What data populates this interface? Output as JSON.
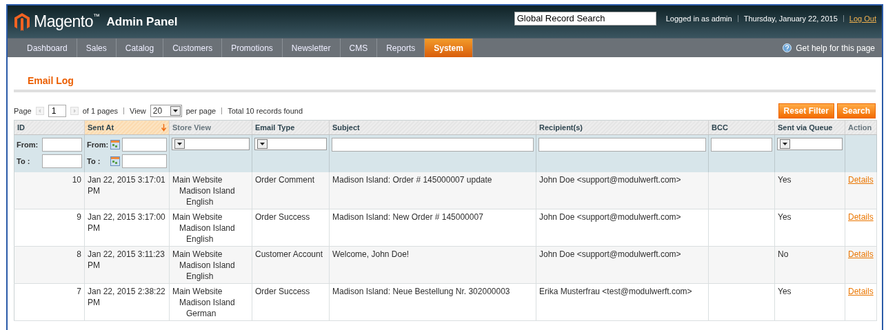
{
  "header": {
    "logo": "Magento",
    "logo_mark": "™",
    "logo_suffix": "Admin Panel",
    "search": {
      "value": "Global Record Search"
    },
    "user": "Logged in as admin",
    "date": "Thursday, January 22, 2015",
    "logout": "Log Out"
  },
  "nav": {
    "items": [
      {
        "label": "Dashboard",
        "selected": false
      },
      {
        "label": "Sales",
        "selected": false
      },
      {
        "label": "Catalog",
        "selected": false
      },
      {
        "label": "Customers",
        "selected": false
      },
      {
        "label": "Promotions",
        "selected": false
      },
      {
        "label": "Newsletter",
        "selected": false
      },
      {
        "label": "CMS",
        "selected": false
      },
      {
        "label": "Reports",
        "selected": false
      },
      {
        "label": "System",
        "selected": true
      }
    ],
    "help": "Get help for this page"
  },
  "page_title": "Email Log",
  "pager": {
    "page_label": "Page",
    "page": "1",
    "of_pages": "of 1 pages",
    "view_label": "View",
    "per_page": "20",
    "per_page_label": "per page",
    "total": "Total 10 records found"
  },
  "buttons": [
    "Reset Filter",
    "Search"
  ],
  "table": {
    "columns": [
      {
        "label": "ID",
        "sortable": true,
        "sorted": false,
        "filter": {
          "kind": "range",
          "from": "From:",
          "to": "To :"
        }
      },
      {
        "label": "Sent At",
        "sortable": true,
        "sorted": true,
        "filter": {
          "kind": "date_range",
          "from": "From:",
          "to": "To :"
        }
      },
      {
        "label": "Store View",
        "sortable": false,
        "sorted": false,
        "filter": {
          "kind": "select"
        }
      },
      {
        "label": "Email Type",
        "sortable": true,
        "sorted": false,
        "filter": {
          "kind": "select"
        }
      },
      {
        "label": "Subject",
        "sortable": true,
        "sorted": false,
        "filter": {
          "kind": "text"
        }
      },
      {
        "label": "Recipient(s)",
        "sortable": true,
        "sorted": false,
        "filter": {
          "kind": "text"
        }
      },
      {
        "label": "BCC",
        "sortable": true,
        "sorted": false,
        "filter": {
          "kind": "text"
        }
      },
      {
        "label": "Sent via Queue",
        "sortable": true,
        "sorted": false,
        "filter": {
          "kind": "select"
        }
      },
      {
        "label": "Action",
        "sortable": false,
        "sorted": false,
        "filter": {
          "kind": "none"
        }
      }
    ],
    "rows": [
      {
        "id": "10",
        "sent_at": "Jan 22, 2015 3:17:01 PM",
        "store_view": [
          "Main Website",
          "Madison Island",
          "English"
        ],
        "email_type": "Order Comment",
        "subject": "Madison Island: Order # 145000007 update",
        "recipients": "John Doe <support@modulwerft.com>",
        "queue": "Yes",
        "action": "Details"
      },
      {
        "id": "9",
        "sent_at": "Jan 22, 2015 3:17:00 PM",
        "store_view": [
          "Main Website",
          "Madison Island",
          "English"
        ],
        "email_type": "Order Success",
        "subject": "Madison Island: New Order # 145000007",
        "recipients": "John Doe <support@modulwerft.com>",
        "queue": "Yes",
        "action": "Details"
      },
      {
        "id": "8",
        "sent_at": "Jan 22, 2015 3:11:23 PM",
        "store_view": [
          "Main Website",
          "Madison Island",
          "English"
        ],
        "email_type": "Customer Account",
        "subject": "Welcome, John Doe!",
        "recipients": "John Doe <support@modulwerft.com>",
        "queue": "No",
        "action": "Details"
      },
      {
        "id": "7",
        "sent_at": "Jan 22, 2015 2:38:22 PM",
        "store_view": [
          "Main Website",
          "Madison Island",
          "German"
        ],
        "email_type": "Order Success",
        "subject": "Madison Island: Neue Bestellung Nr. 302000003",
        "recipients": "Erika Musterfrau <test@modulwerft.com>",
        "queue": "Yes",
        "action": "Details"
      }
    ]
  }
}
